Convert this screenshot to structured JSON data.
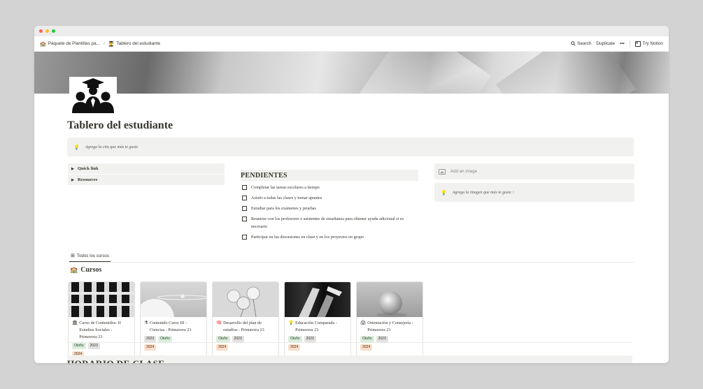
{
  "breadcrumb": {
    "parent": "Paquete de Plantillas pa...",
    "current": "Tablero del estudiante"
  },
  "topbar": {
    "search": "Search",
    "duplicate": "Duplicate",
    "more": "•••",
    "try_notion": "Try Notion"
  },
  "page": {
    "title": "Tablero del estudiante",
    "quote_placeholder": "Agrega la cita que más te guste"
  },
  "toggles": [
    {
      "label": "Quick link"
    },
    {
      "label": "Resources"
    }
  ],
  "todo": {
    "heading": "PENDIENTES",
    "items": [
      {
        "text": "Completar las tareas escolares a tiempo",
        "checked": false
      },
      {
        "text": "Asistir a todas las clases y tomar apuntes",
        "checked": false
      },
      {
        "text": "Estudiar para los exámenes y pruebas",
        "checked": false
      },
      {
        "text": "Reunirse con los profesores o asistentes de enseñanza para obtener ayuda adicional si es necesario",
        "checked": false
      },
      {
        "text": "Participar en las discusiones en clase y en los proyectos en grupo",
        "checked": false
      }
    ]
  },
  "image_block": {
    "add_image": "Add an image",
    "image_placeholder": "Agrega la imagen que más te guste ↑"
  },
  "view": {
    "tab_label": "Todos los cursos"
  },
  "courses": {
    "title": "Cursos",
    "cards": [
      {
        "name": "Curso de Contenidos- II Estudios Sociales - Primavera 23",
        "icon": "building-icon",
        "tags": [
          "Otoño",
          "2023"
        ],
        "year_tag": "2024"
      },
      {
        "name": "Contenido Curso III - Ciencias - Primavera 23",
        "icon": "flask-icon",
        "tags": [
          "2023",
          "Otoño"
        ],
        "year_tag": "2024"
      },
      {
        "name": "Desarrollo del plan de estudios - Primavera 23",
        "icon": "brain-icon",
        "tags": [
          "Otoño",
          "2023"
        ],
        "year_tag": "2024"
      },
      {
        "name": "Educación Comparada - Primavera 23",
        "icon": "lightbulb-icon",
        "tags": [
          "Otoño",
          "2023"
        ],
        "year_tag": "2024"
      },
      {
        "name": "Orientación y Consejería - Primavera 23",
        "icon": "printer-icon",
        "tags": [
          "Otoño",
          "2023"
        ],
        "year_tag": "2024"
      }
    ]
  },
  "schedule": {
    "heading": "HORARIO DE CLASE"
  },
  "colors": {
    "tag_green": "#dbeddb",
    "tag_gray": "#e3e2e0",
    "tag_orange": "#fadec9",
    "callout_bg": "#f1f1ef"
  }
}
